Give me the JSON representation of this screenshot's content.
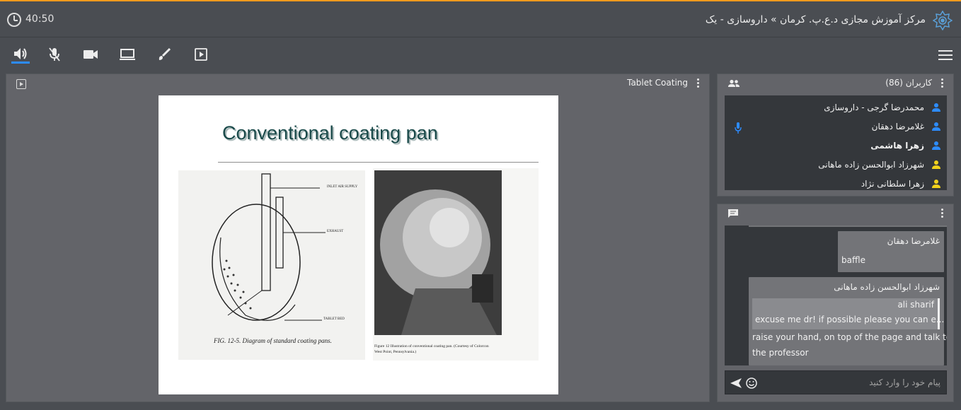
{
  "header": {
    "timer": "40:50",
    "title": "مرکز آموزش مجازی د.ع.پ. کرمان » داروسازی - یک",
    "accent_color": "#f39a1c"
  },
  "toolbar": {
    "icons": [
      "speaker-icon",
      "mic-off-icon",
      "camera-icon",
      "screen-share-icon",
      "brush-icon",
      "play-box-icon",
      "menu-icon"
    ]
  },
  "presentation": {
    "title": "Tablet Coating",
    "slide_title": "Conventional coating pan",
    "fig1_labels": {
      "inlet": "INLET AIR SUPPLY",
      "exhaust": "EXHAUST",
      "bed": "TABLET BED",
      "caption": "FIG. 12-5. Diagram of standard coating pans."
    },
    "fig2_caption_line1": "Figure 12   Illustration of conventional coating pan.  (Courtesy of Colorcon",
    "fig2_caption_line2": "West Point, Pennsylvania.)"
  },
  "users": {
    "header": "کاربران (86)",
    "list": [
      {
        "name": "محمدرضا گرجی - داروسازی",
        "color": "#2d8cff",
        "bold": false
      },
      {
        "name": "غلامرضا دهقان",
        "color": "#2d8cff",
        "bold": false
      },
      {
        "name": "زهرا هاشمی",
        "color": "#2d8cff",
        "bold": true
      },
      {
        "name": "شهرزاد ابوالحسن زاده ماهانی",
        "color": "#f2d21c",
        "bold": false
      },
      {
        "name": "زهرا سلطانی نژاد",
        "color": "#f2d21c",
        "bold": false
      }
    ]
  },
  "chat": {
    "messages": [
      {
        "sender": "غلامرضا دهقان",
        "lines": [
          "baffle"
        ]
      },
      {
        "sender": "شهرزاد ابوالحسن زاده ماهانی",
        "quote_name": "ali sharif",
        "quote_text": "excuse me dr! if possible please you can e...",
        "lines": [
          "raise your hand, on top of the page and talk to",
          "the professor"
        ]
      }
    ],
    "placeholder": "پیام خود را وارد کنید"
  }
}
